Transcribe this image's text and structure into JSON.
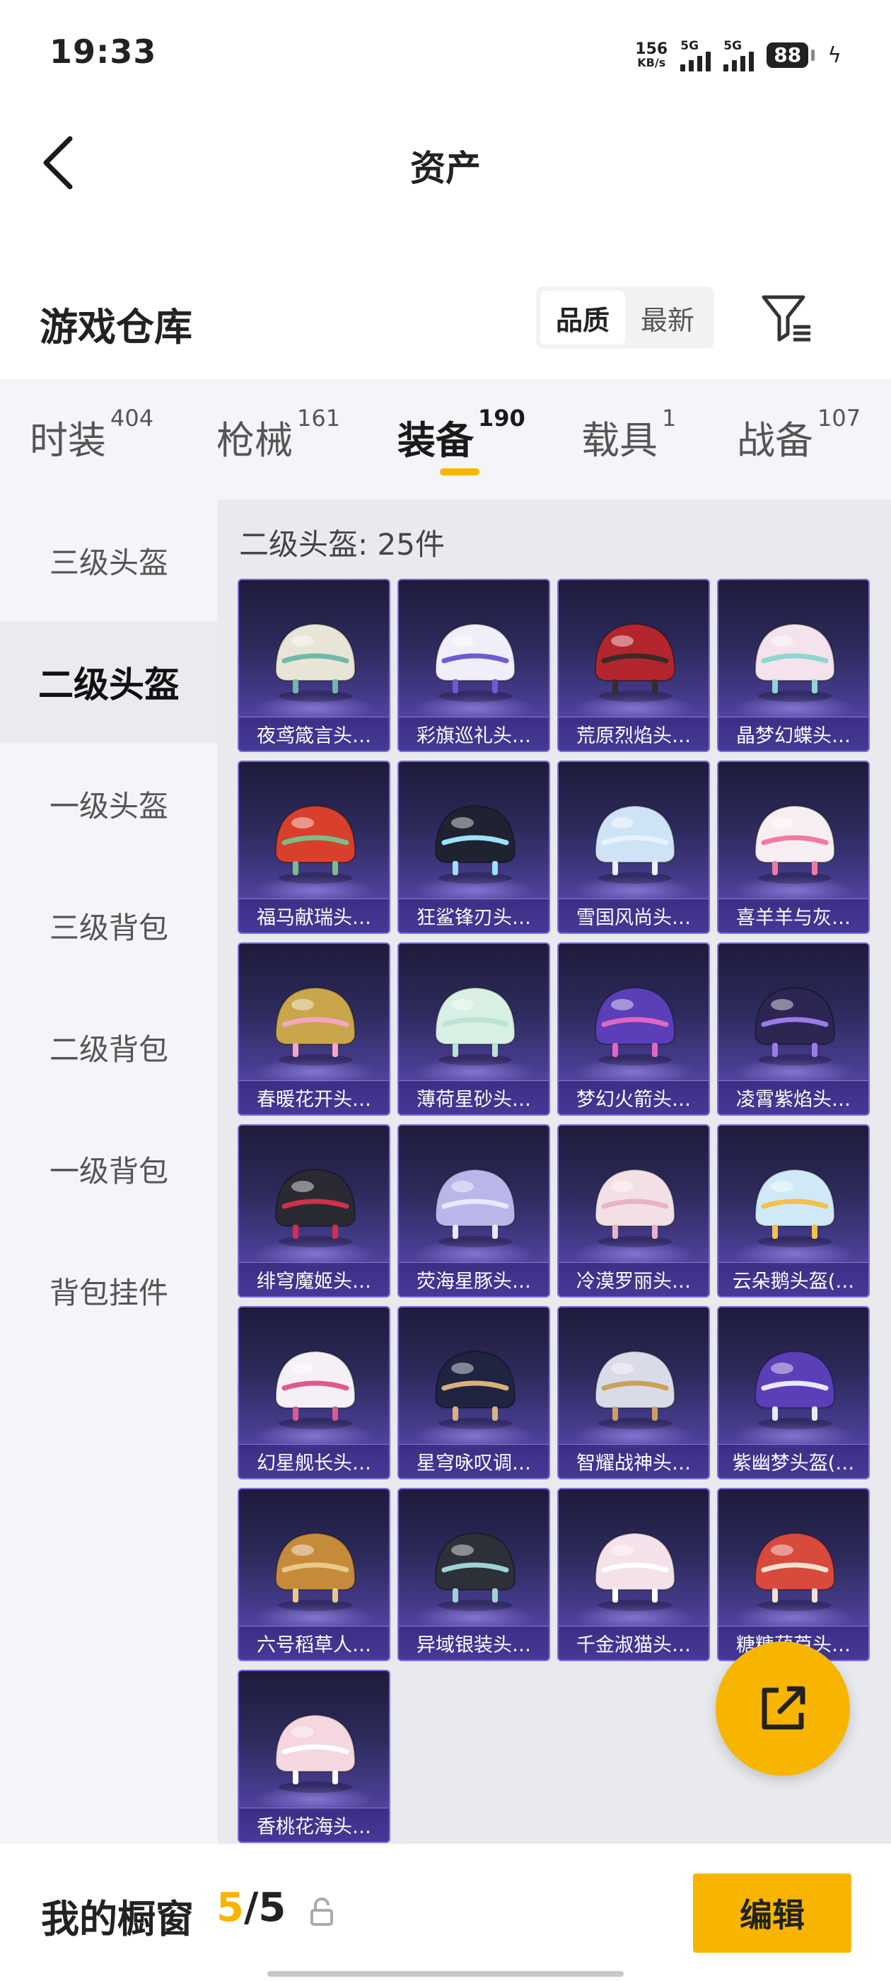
{
  "status_bar": {
    "time": "19:33",
    "net_speed_value": "156",
    "net_speed_unit": "KB/s",
    "signal1_label": "5G",
    "signal2_label": "5G",
    "battery": "88"
  },
  "header": {
    "title": "资产"
  },
  "warehouse": {
    "title": "游戏仓库",
    "sort_options": [
      "品质",
      "最新"
    ],
    "sort_selected": "品质"
  },
  "tabs": [
    {
      "label": "时装",
      "count": "404"
    },
    {
      "label": "枪械",
      "count": "161"
    },
    {
      "label": "装备",
      "count": "190",
      "active": true
    },
    {
      "label": "载具",
      "count": "1"
    },
    {
      "label": "战备",
      "count": "107"
    }
  ],
  "sidebar": {
    "items": [
      "三级头盔",
      "二级头盔",
      "一级头盔",
      "三级背包",
      "二级背包",
      "一级背包",
      "背包挂件"
    ],
    "active": "二级头盔"
  },
  "content": {
    "title": "二级头盔: 25件",
    "items": [
      {
        "name": "夜鸢箴言头…",
        "color": "#e8e4d6",
        "accent": "#6fb9a8"
      },
      {
        "name": "彩旗巡礼头…",
        "color": "#f1eefa",
        "accent": "#6d5bd0"
      },
      {
        "name": "荒原烈焰头…",
        "color": "#b3262e",
        "accent": "#3a2a2a"
      },
      {
        "name": "晶梦幻蝶头…",
        "color": "#f4e3ec",
        "accent": "#8fd6d0"
      },
      {
        "name": "福马献瑞头…",
        "color": "#d8402c",
        "accent": "#7bbd8a"
      },
      {
        "name": "狂鲨锋刃头…",
        "color": "#1f2230",
        "accent": "#9de2ff"
      },
      {
        "name": "雪国风尚头…",
        "color": "#cfe3f7",
        "accent": "#e9f3ff"
      },
      {
        "name": "喜羊羊与灰…",
        "color": "#f7eef1",
        "accent": "#f07aa4"
      },
      {
        "name": "春暖花开头…",
        "color": "#c9a64c",
        "accent": "#f5a6c0"
      },
      {
        "name": "薄荷星砂头…",
        "color": "#d8efe3",
        "accent": "#b9e4d4"
      },
      {
        "name": "梦幻火箭头…",
        "color": "#5b3fb8",
        "accent": "#e265c4"
      },
      {
        "name": "凌霄紫焰头…",
        "color": "#2b2752",
        "accent": "#9a7be8"
      },
      {
        "name": "绯穹魔姬头…",
        "color": "#2a2a32",
        "accent": "#d0304a"
      },
      {
        "name": "荧海星豚头…",
        "color": "#b9b7ea",
        "accent": "#e8e8ff"
      },
      {
        "name": "冷漠罗丽头…",
        "color": "#f3dfe6",
        "accent": "#e7b4c6"
      },
      {
        "name": "云朵鹅头盔(…",
        "color": "#cfeaf6",
        "accent": "#f2c14e"
      },
      {
        "name": "幻星舰长头…",
        "color": "#f4f0f6",
        "accent": "#e0578e"
      },
      {
        "name": "星穹咏叹调…",
        "color": "#1f2440",
        "accent": "#d8b27a"
      },
      {
        "name": "智耀战神头…",
        "color": "#d9dbe8",
        "accent": "#c9a15a"
      },
      {
        "name": "紫幽梦头盔(…",
        "color": "#5b3fb8",
        "accent": "#e8e8ff"
      },
      {
        "name": "六号稻草人…",
        "color": "#c68b3a",
        "accent": "#e8c98a"
      },
      {
        "name": "异域银装头…",
        "color": "#2d3038",
        "accent": "#9fd2d6"
      },
      {
        "name": "千金淑猫头…",
        "color": "#f5e1ea",
        "accent": "#ffffff"
      },
      {
        "name": "糖糖葫芦头…",
        "color": "#d84a3c",
        "accent": "#f4e1d0"
      },
      {
        "name": "香桃花海头…",
        "color": "#f5d7df",
        "accent": "#ffffff"
      }
    ]
  },
  "showcase": {
    "label": "我的橱窗",
    "current": "5",
    "total": "5",
    "edit_label": "编辑"
  },
  "colors": {
    "accent": "#f7b500",
    "card_top": "#1e1b3b",
    "card_bottom": "#6b5cc8"
  }
}
